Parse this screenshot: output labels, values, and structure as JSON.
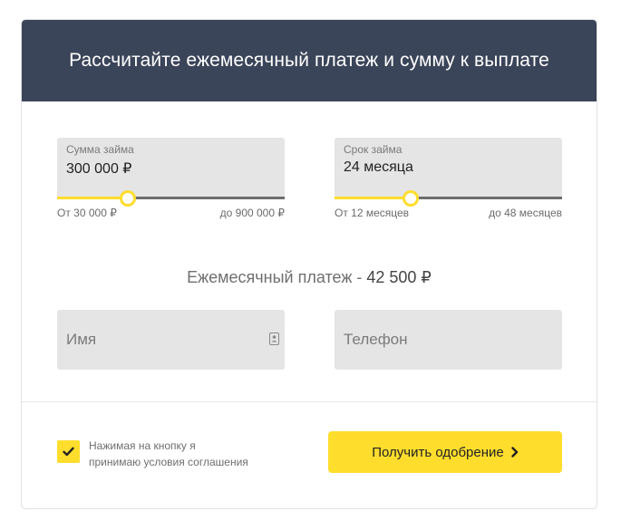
{
  "header": {
    "title": "Рассчитайте ежемесячный платеж и сумму к выплате"
  },
  "loan_amount": {
    "caption": "Сумма займа",
    "value": "300 000 ₽",
    "min_label": "От 30 000 ₽",
    "max_label": "до 900 000 ₽",
    "fill_fraction": 0.31
  },
  "loan_term": {
    "caption": "Срок займа",
    "value": "24 месяца",
    "min_label": "От 12 месяцев",
    "max_label": "до 48 месяцев",
    "fill_fraction": 0.335
  },
  "payment": {
    "label": "Ежемесячный платеж - ",
    "amount": "42 500 ₽"
  },
  "form": {
    "name_placeholder": "Имя",
    "phone_placeholder": "Телефон",
    "contact_icon": "contact-card-icon"
  },
  "footer": {
    "agree_line1": "Нажимая на кнопку я",
    "agree_line2": "принимаю условия соглашения",
    "checked": true,
    "button_label": "Получить одобрение"
  },
  "colors": {
    "header_bg": "#3b4559",
    "accent": "#ffdd2d",
    "field_bg": "#e5e5e5",
    "track": "#6d6d6d"
  }
}
